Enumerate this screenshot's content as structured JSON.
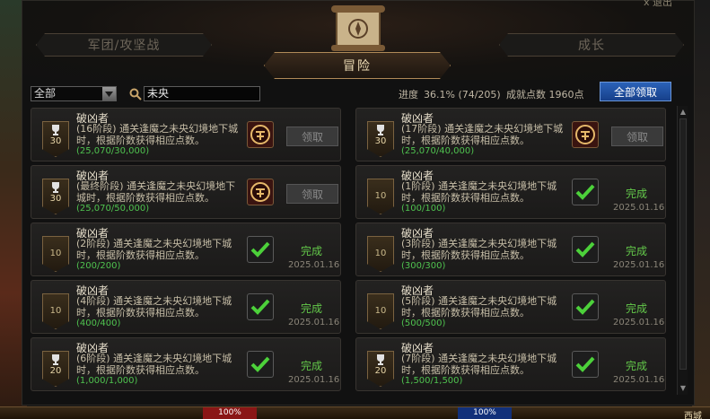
{
  "window": {
    "close_hint": "x 退出"
  },
  "tabs": {
    "left": "军团/攻坚战",
    "active": "冒险",
    "right": "成长"
  },
  "filter": {
    "category_selected": "全部",
    "search_value": "未央"
  },
  "stats": {
    "progress_label": "进度",
    "progress_value": "36.1% (74/205)",
    "points_label": "成就点数 1960点"
  },
  "claim_all_label": "全部领取",
  "cards": [
    {
      "badge_icon": "trophy-icon",
      "badge_num": "30",
      "title": "破凶者",
      "desc": "(16阶段) 通关逢魔之未央幻境地下城时，根据阶数获得相应点数。",
      "progress": "(25,070/30,000)",
      "action": "领取",
      "status": "",
      "date": ""
    },
    {
      "badge_icon": "trophy-icon",
      "badge_num": "30",
      "title": "破凶者",
      "desc": "(17阶段) 通关逢魔之未央幻境地下城时，根据阶数获得相应点数。",
      "progress": "(25,070/40,000)",
      "action": "领取",
      "status": "",
      "date": ""
    },
    {
      "badge_icon": "trophy-icon",
      "badge_num": "30",
      "title": "破凶者",
      "desc": "(最终阶段) 通关逢魔之未央幻境地下城时，根据阶数获得相应点数。",
      "progress": "(25,070/50,000)",
      "action": "领取",
      "status": "",
      "date": ""
    },
    {
      "badge_icon": "",
      "badge_num": "10",
      "title": "破凶者",
      "desc": "(1阶段) 通关逢魔之未央幻境地下城时，根据阶数获得相应点数。",
      "progress": "(100/100)",
      "action": "",
      "status": "完成",
      "date": "2025.01.16"
    },
    {
      "badge_icon": "",
      "badge_num": "10",
      "title": "破凶者",
      "desc": "(2阶段) 通关逢魔之未央幻境地下城时，根据阶数获得相应点数。",
      "progress": "(200/200)",
      "action": "",
      "status": "完成",
      "date": "2025.01.16"
    },
    {
      "badge_icon": "",
      "badge_num": "10",
      "title": "破凶者",
      "desc": "(3阶段) 通关逢魔之未央幻境地下城时，根据阶数获得相应点数。",
      "progress": "(300/300)",
      "action": "",
      "status": "完成",
      "date": "2025.01.16"
    },
    {
      "badge_icon": "",
      "badge_num": "10",
      "title": "破凶者",
      "desc": "(4阶段) 通关逢魔之未央幻境地下城时，根据阶数获得相应点数。",
      "progress": "(400/400)",
      "action": "",
      "status": "完成",
      "date": "2025.01.16"
    },
    {
      "badge_icon": "",
      "badge_num": "10",
      "title": "破凶者",
      "desc": "(5阶段) 通关逢魔之未央幻境地下城时，根据阶数获得相应点数。",
      "progress": "(500/500)",
      "action": "",
      "status": "完成",
      "date": "2025.01.16"
    },
    {
      "badge_icon": "trophy-icon",
      "badge_num": "20",
      "title": "破凶者",
      "desc": "(6阶段) 通关逢魔之未央幻境地下城时，根据阶数获得相应点数。",
      "progress": "(1,000/1,000)",
      "action": "",
      "status": "完成",
      "date": "2025.01.16"
    },
    {
      "badge_icon": "trophy-icon",
      "badge_num": "20",
      "title": "破凶者",
      "desc": "(7阶段) 通关逢魔之未央幻境地下城时，根据阶数获得相应点数。",
      "progress": "(1,500/1,500)",
      "action": "",
      "status": "完成",
      "date": "2025.01.16"
    }
  ],
  "bottombar": {
    "hp": "100%",
    "mp": "100%",
    "town": "西城"
  },
  "colors": {
    "accent_blue": "#2b62b8",
    "complete_green": "#63c84a",
    "progress_green": "#4fc24f",
    "gold": "#b08a58"
  }
}
